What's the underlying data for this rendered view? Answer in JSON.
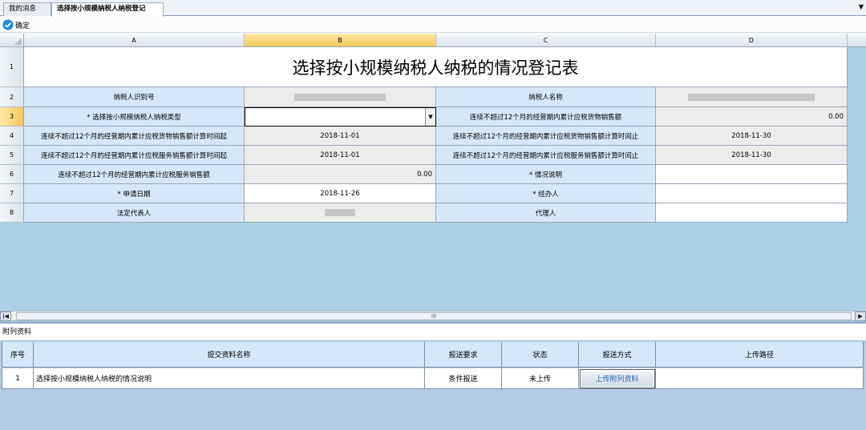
{
  "tabs": {
    "messages": "我的消息",
    "active": "选择按小规模纳税人纳税登记"
  },
  "toolbar": {
    "confirm_label": "确定",
    "confirm_icon": "check-circle-icon"
  },
  "sheet": {
    "columns": [
      "A",
      "B",
      "C",
      "D"
    ],
    "selected_column": "B",
    "selected_row": "3",
    "rows": [
      "1",
      "2",
      "3",
      "4",
      "5",
      "6",
      "7",
      "8"
    ],
    "title": "选择按小规模纳税人纳税的情况登记表",
    "r2": {
      "a": "纳税人识别号",
      "c": "纳税人名称"
    },
    "r3": {
      "a": "* 选择按小规模纳税人纳税类型",
      "b": "",
      "c": "连续不超过12个月的经营期内累计应税货物销售额",
      "d": "0.00"
    },
    "r4": {
      "a": "连续不超过12个月的经营期内累计应税货物销售额计算时间起",
      "b": "2018-11-01",
      "c": "连续不超过12个月的经营期内累计应税货物销售额计算时间止",
      "d": "2018-11-30"
    },
    "r5": {
      "a": "连续不超过12个月的经营期内累计应税服务销售额计算时间起",
      "b": "2018-11-01",
      "c": "连续不超过12个月的经营期内累计应税服务销售额计算时间止",
      "d": "2018-11-30"
    },
    "r6": {
      "a": "连续不超过12个月的经营期内累计应税服务销售额",
      "b": "0.00",
      "c": "* 情况说明",
      "d": ""
    },
    "r7": {
      "a": "* 申请日期",
      "b": "2018-11-26",
      "c": "* 经办人",
      "d": ""
    },
    "r8": {
      "a": "法定代表人",
      "c": "代理人",
      "d": ""
    }
  },
  "scrollbar": {
    "grip": "III"
  },
  "attachments": {
    "section_title": "附列资料",
    "headers": [
      "序号",
      "提交资料名称",
      "报送要求",
      "状态",
      "报送方式",
      "上传路径"
    ],
    "rows": [
      {
        "no": "1",
        "name": "选择按小规模纳税人纳税的情况说明",
        "requirement": "条件报送",
        "status": "未上传",
        "action": "上传附列资料",
        "path": ""
      }
    ]
  },
  "colors": {
    "label_bg": "#d6e7f7",
    "gray_bg": "#ececec",
    "sheet_bg": "#a9d1e3",
    "selected_header": "#f5c85a",
    "upload_text": "#1a5fb4"
  }
}
